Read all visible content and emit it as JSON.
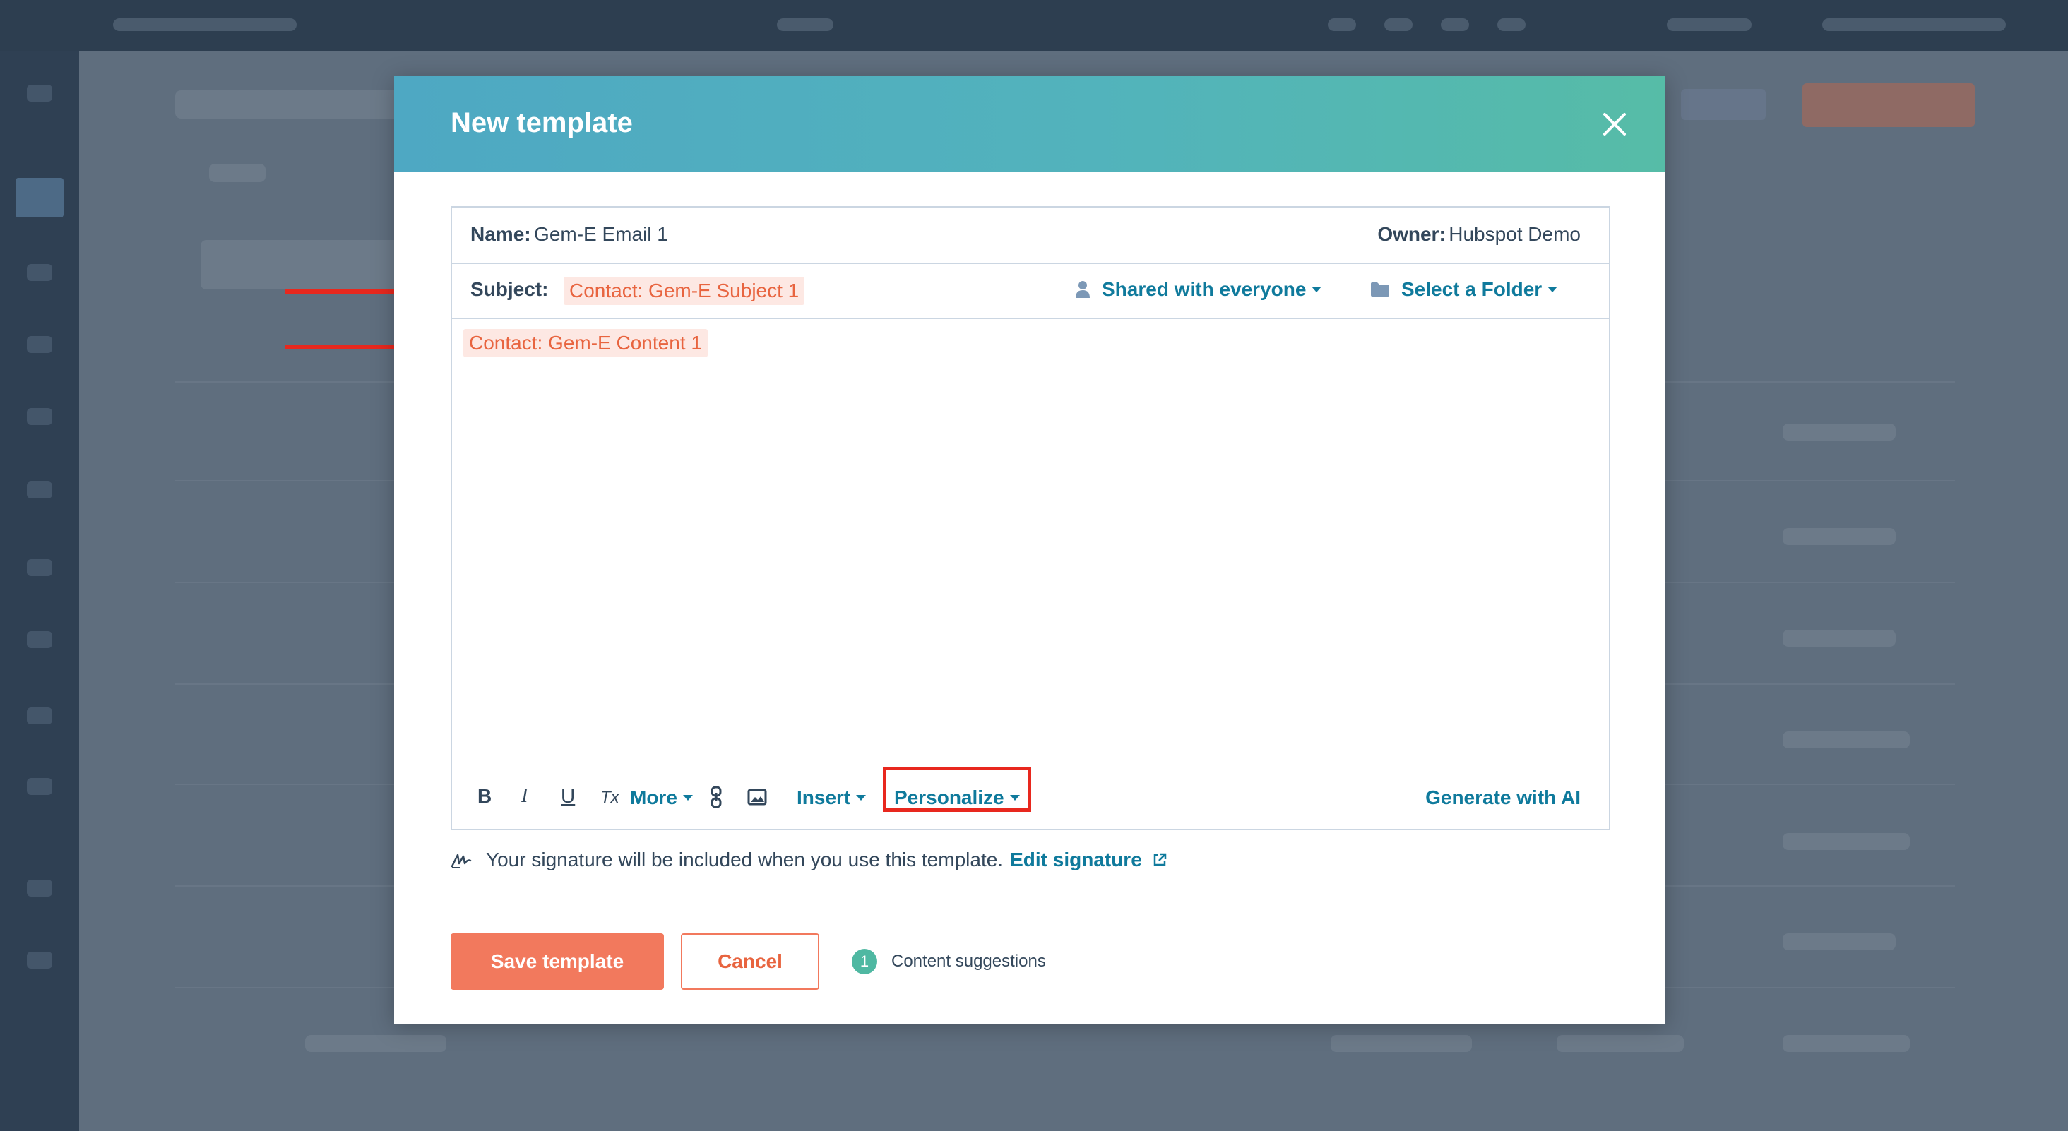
{
  "modal": {
    "title": "New template",
    "name_label": "Name:",
    "name_value": "Gem-E Email 1",
    "owner_label": "Owner:",
    "owner_value": "Hubspot Demo",
    "subject_label": "Subject:",
    "subject_token": "Contact: Gem-E Subject 1",
    "sharing_label": "Shared with everyone",
    "folder_label": "Select a Folder",
    "body_token": "Contact: Gem-E Content 1"
  },
  "toolbar": {
    "bold": "B",
    "italic": "I",
    "underline": "U",
    "clear_format": "Tx",
    "more_label": "More",
    "insert_label": "Insert",
    "personalize_label": "Personalize",
    "generate_ai_label": "Generate with AI"
  },
  "signature": {
    "text": "Your signature will be included when you use this template.",
    "link": "Edit signature"
  },
  "footer": {
    "save_label": "Save template",
    "cancel_label": "Cancel",
    "suggestions_count": "1",
    "suggestions_label": "Content suggestions"
  },
  "colors": {
    "accent": "#0f7a9c",
    "primary_button": "#f2795d",
    "token_text": "#e8643f",
    "highlight": "#e8281e",
    "header_gradient_start": "#4ea8c3",
    "header_gradient_end": "#56bca7"
  }
}
